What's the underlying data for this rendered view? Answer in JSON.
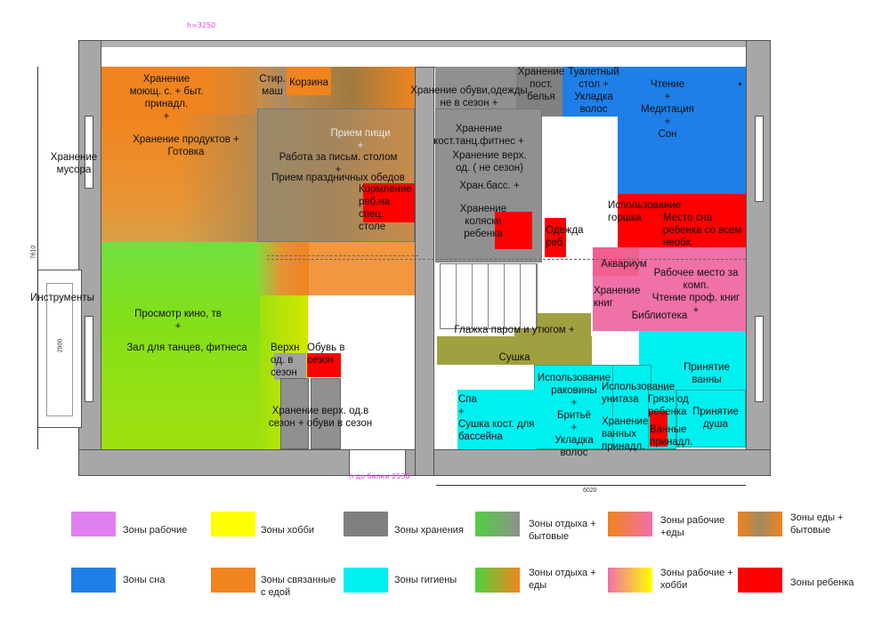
{
  "dimensions": {
    "top": "h=3250",
    "bottom_pink": "h до балки 2536",
    "bottom_width": "6020",
    "left_upper": "7610",
    "left_lower": "2900"
  },
  "labels": {
    "storage_detergents": "Хранение\nмоющ. с. + быт. принадл.\n+",
    "washer": "Стир.\nмаш",
    "basket": "Корзина",
    "storage_food": "Хранение продуктов +\nГотовка",
    "storage_trash": "Хранение\nмусора",
    "food_intake": "Прием пищи\n+",
    "desk_work": "Работа за письм. столом\n+",
    "dinners": "Прием праздничных обедов",
    "child_feeding": "Кормление\nреб.на\nспец.\nстоле",
    "tools": "Инструменты",
    "movies": "Просмотр кино, тв\n+",
    "dance_hall": "Зал для танцев, фитнеса",
    "outerwear": "Верхн\nод. в\nсезон",
    "shoes_season": "Обувь в\nсезон",
    "storage_outer": "Хранение верх. од.в\nсезон + обуви в сезон",
    "storage_shoes_off": "Хранение обуви,одежды\nне в сезон +",
    "storage_linen": "Хранение\nпост.\nбелья",
    "dressing_table": "Туалетный\nстол +\nУкладка\nволос",
    "reading": "Чтение\n+\nМедитация\n+\nСон",
    "storage_dance": "Хранение\nкост.танц.фитнес +",
    "storage_outer_off": "Хранение верх.\nод. ( не сезон)",
    "storage_pool": "Хран.басс.     +",
    "stroller": "Хранение\nколяски\nребенка",
    "child_clothes": "Одежда\nреб.",
    "potty": "Использование\nгоршка",
    "child_bed": "Место сна\nребенка со всем\nнеобх.",
    "aquarium": "Аквариум",
    "workplace": "Рабочее место за\nкомп.\nЧтение проф. книг\n+",
    "books": "Хранение\nкниг",
    "library": "Библиотека",
    "ironing": "Глажка паром и утюгом +",
    "drying": "Сушка",
    "sleep_pool": "Спа\n+\nСушка кост. для\nбассейна",
    "sink": "Использование\nраковины\n+\nБритьё\n+\nУкладка\nволос",
    "toilet": "Использование\nунитаза",
    "bath_storage": "Хранение\nванных\nпринадл.",
    "dirty_clothes": "Грязн од\nребенка",
    "bath": "Принятие\nванны",
    "shower": "Принятие\nдуша",
    "bath_items": "Ванные\nпринадл."
  },
  "legend": [
    {
      "label": "Зоны рабочие",
      "color": "#e080f0"
    },
    {
      "label": "Зоны хобби",
      "color": "#ffff00"
    },
    {
      "label": "Зоны хранения",
      "color": "#808080"
    },
    {
      "label": "Зоны отдыха +\nбытовые",
      "color": "gradient-green-gray"
    },
    {
      "label": "Зоны рабочие\n+еды",
      "color": "gradient-orange-pink"
    },
    {
      "label": "Зоны еды +\nбытовые",
      "color": "gradient-orange-gray"
    },
    {
      "label": "Зоны сна",
      "color": "#1e7fe8"
    },
    {
      "label": "Зоны связанные\nс едой",
      "color": "#f0841e"
    },
    {
      "label": "Зоны гигиены",
      "color": "#00f0f0"
    },
    {
      "label": "Зоны отдыха +\nеды",
      "color": "gradient-green-orange"
    },
    {
      "label": "Зоны рабочие +\nхобби",
      "color": "gradient-pink-yellow"
    },
    {
      "label": "Зоны ребенка",
      "color": "#ff0000"
    }
  ]
}
